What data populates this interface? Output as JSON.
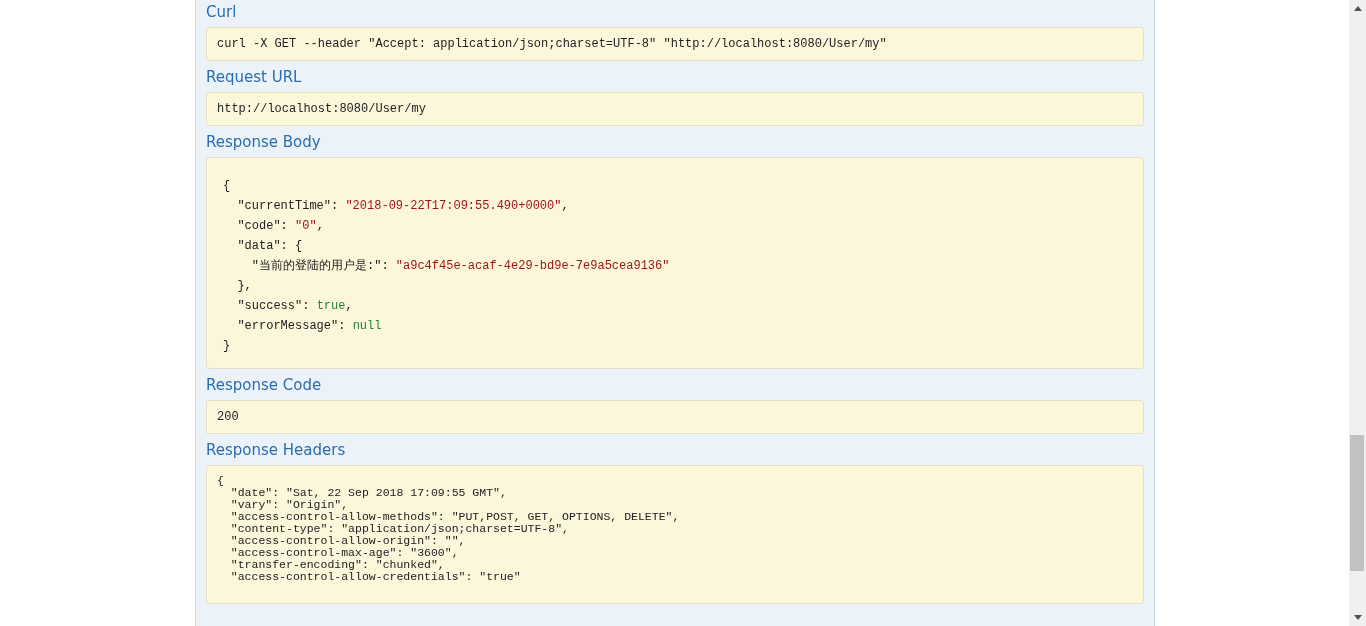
{
  "sections": [
    {
      "title": "Curl",
      "kind": "block",
      "lines": [
        [
          {
            "kind": "plain",
            "text": "curl -X GET --header \"Accept: application/json;charset=UTF-8\" \"http://localhost:8080/User/my\""
          }
        ]
      ]
    },
    {
      "title": "Request URL",
      "kind": "block",
      "lines": [
        [
          {
            "kind": "plain",
            "text": "http://localhost:8080/User/my"
          }
        ]
      ]
    },
    {
      "title": "Response Body",
      "kind": "json",
      "lines": [
        [
          {
            "kind": "plain",
            "text": "{"
          }
        ],
        [
          {
            "kind": "plain",
            "text": "  \"currentTime\": "
          },
          {
            "kind": "string",
            "text": "\"2018-09-22T17:09:55.490+0000\""
          },
          {
            "kind": "plain",
            "text": ","
          }
        ],
        [
          {
            "kind": "plain",
            "text": "  \"code\": "
          },
          {
            "kind": "string",
            "text": "\"0\""
          },
          {
            "kind": "plain",
            "text": ","
          }
        ],
        [
          {
            "kind": "plain",
            "text": "  \"data\": {"
          }
        ],
        [
          {
            "kind": "plain",
            "text": "    \"当前的登陆的用户是:\": "
          },
          {
            "kind": "string",
            "text": "\"a9c4f45e-acaf-4e29-bd9e-7e9a5cea9136\""
          }
        ],
        [
          {
            "kind": "plain",
            "text": "  },"
          }
        ],
        [
          {
            "kind": "plain",
            "text": "  \"success\": "
          },
          {
            "kind": "literal",
            "text": "true"
          },
          {
            "kind": "plain",
            "text": ","
          }
        ],
        [
          {
            "kind": "plain",
            "text": "  \"errorMessage\": "
          },
          {
            "kind": "literal",
            "text": "null"
          }
        ],
        [
          {
            "kind": "plain",
            "text": "}"
          }
        ]
      ]
    },
    {
      "title": "Response Code",
      "kind": "block",
      "lines": [
        [
          {
            "kind": "plain",
            "text": "200"
          }
        ]
      ]
    },
    {
      "title": "Response Headers",
      "kind": "headers",
      "lines": [
        [
          {
            "kind": "plain",
            "text": "{"
          }
        ],
        [
          {
            "kind": "plain",
            "text": "  \"date\": \"Sat, 22 Sep 2018 17:09:55 GMT\","
          }
        ],
        [
          {
            "kind": "plain",
            "text": "  \"vary\": \"Origin\","
          }
        ],
        [
          {
            "kind": "plain",
            "text": "  \"access-control-allow-methods\": \"PUT,POST, GET, OPTIONS, DELETE\","
          }
        ],
        [
          {
            "kind": "plain",
            "text": "  \"content-type\": \"application/json;charset=UTF-8\","
          }
        ],
        [
          {
            "kind": "plain",
            "text": "  \"access-control-allow-origin\": \"\","
          }
        ],
        [
          {
            "kind": "plain",
            "text": "  \"access-control-max-age\": \"3600\","
          }
        ],
        [
          {
            "kind": "plain",
            "text": "  \"transfer-encoding\": \"chunked\","
          }
        ],
        [
          {
            "kind": "plain",
            "text": "  \"access-control-allow-credentials\": \"true\""
          }
        ]
      ]
    }
  ]
}
